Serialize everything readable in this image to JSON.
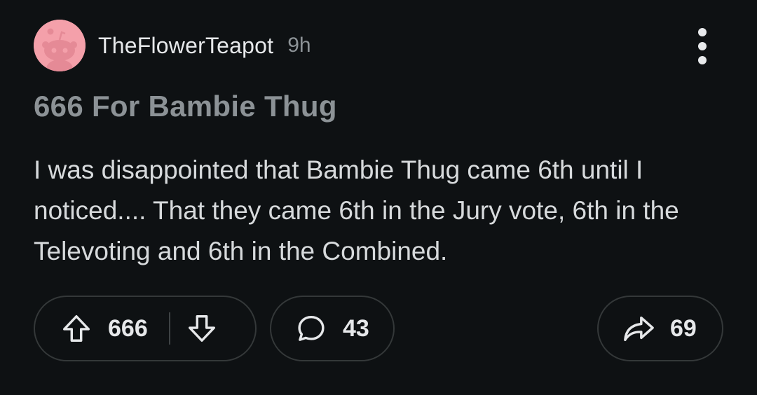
{
  "post": {
    "author": "TheFlowerTeapot",
    "time_ago": "9h",
    "title": "666 For Bambie Thug",
    "body": "I was disappointed that Bambie Thug came 6th until I noticed.... That they came 6th in the Jury vote, 6th in the Televoting and 6th in the Combined."
  },
  "actions": {
    "score": "666",
    "comments": "43",
    "shares": "69"
  },
  "colors": {
    "background": "#0e1113",
    "avatar": "#f4a0aa",
    "title": "#8c9296",
    "text": "#d7dadc"
  },
  "icons": {
    "avatar": "snoo-avatar-icon",
    "more": "more-vertical-icon",
    "upvote": "arrow-up-icon",
    "downvote": "arrow-down-icon",
    "comment": "comment-bubble-icon",
    "share": "share-arrow-icon"
  }
}
